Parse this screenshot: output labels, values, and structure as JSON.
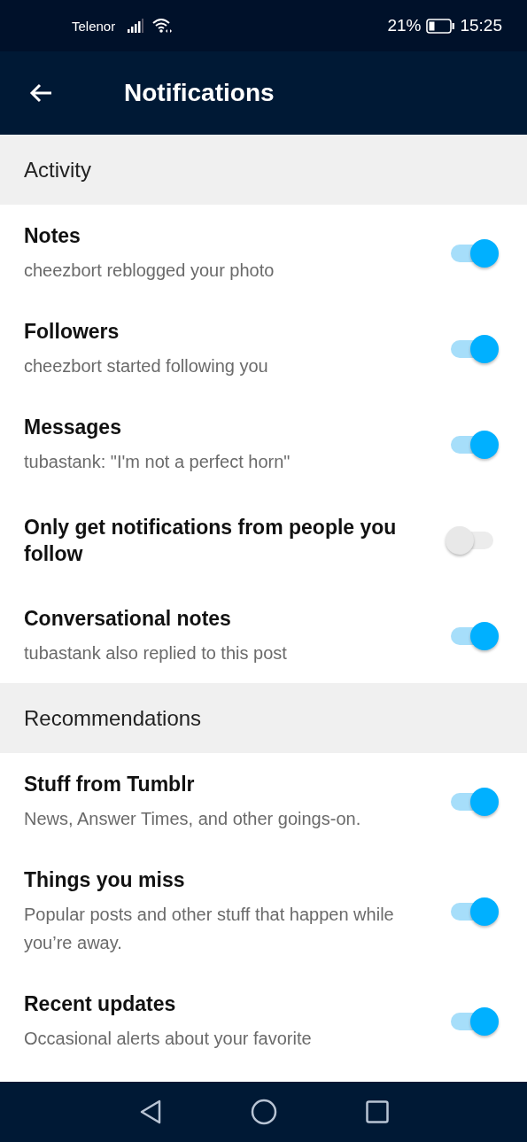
{
  "status_bar": {
    "carrier": "Telenor",
    "battery": "21%",
    "time": "15:25"
  },
  "app_bar": {
    "title": "Notifications"
  },
  "sections": [
    {
      "title": "Activity",
      "items": [
        {
          "title": "Notes",
          "subtitle": "cheezbort reblogged your photo",
          "on": true
        },
        {
          "title": "Followers",
          "subtitle": "cheezbort started following you",
          "on": true
        },
        {
          "title": "Messages",
          "subtitle": "tubastank: \"I'm not a perfect horn\"",
          "on": true
        },
        {
          "title": "Only get notifications from people you follow",
          "on": false
        },
        {
          "title": "Conversational notes",
          "subtitle": "tubastank also replied to this post",
          "on": true
        }
      ]
    },
    {
      "title": "Recommendations",
      "items": [
        {
          "title": "Stuff from Tumblr",
          "subtitle": "News, Answer Times, and other goings-on.",
          "on": true
        },
        {
          "title": "Things you miss",
          "subtitle": "Popular posts and other stuff that happen while you’re away.",
          "on": true
        },
        {
          "title": "Recent updates",
          "subtitle": "Occasional alerts about your favorite",
          "on": true
        }
      ]
    }
  ]
}
